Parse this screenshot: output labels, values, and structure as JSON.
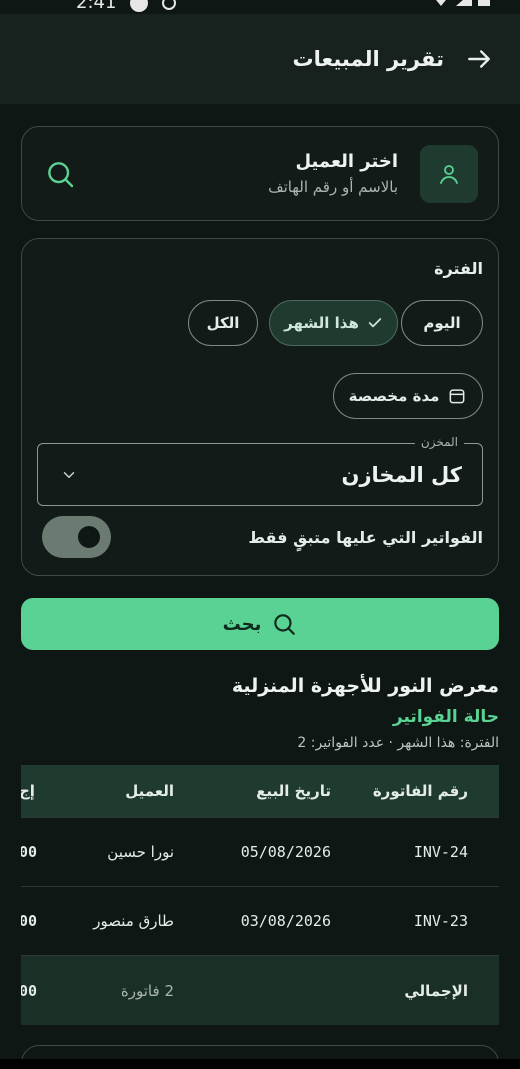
{
  "status_bar": {
    "time": "2:41"
  },
  "app_bar": {
    "title": "تقرير المبيعات"
  },
  "customer_picker": {
    "title": "اختر العميل",
    "subtitle": "بالاسم أو رقم الهاتف"
  },
  "filters": {
    "period_label": "الفترة",
    "chip_today": "اليوم",
    "chip_this_month": "هذا الشهر",
    "chip_all": "الكل",
    "chip_custom": "مدة مخصصة",
    "warehouse_label": "المخزن",
    "warehouse_value": "كل المخازن",
    "outstanding_only_label": "الفواتير التي عليها متبقٍ فقط",
    "outstanding_only_enabled": true
  },
  "search_button": {
    "label": "بحث"
  },
  "report": {
    "shop_name": "معرض النور للأجهزة المنزلية",
    "section_title": "حالة الفواتير",
    "meta": "الفترة: هذا الشهر · عدد الفواتير: 2"
  },
  "table": {
    "headers": {
      "invoice_no": "رقم الفاتورة",
      "sale_date": "تاريخ البيع",
      "customer": "العميل",
      "amount": "إج"
    },
    "rows": [
      {
        "invoice_no": "INV-24",
        "sale_date": "05/08/2026",
        "customer": "نورا حسين",
        "amount": "00"
      },
      {
        "invoice_no": "INV-23",
        "sale_date": "03/08/2026",
        "customer": "طارق منصور",
        "amount": "00"
      }
    ],
    "total": {
      "label": "الإجمالي",
      "count": "2 فاتورة",
      "amount": "00"
    }
  },
  "colors": {
    "accent": "#5ad293",
    "background": "#0f1714",
    "selected_chip": "#1f3a2e"
  }
}
